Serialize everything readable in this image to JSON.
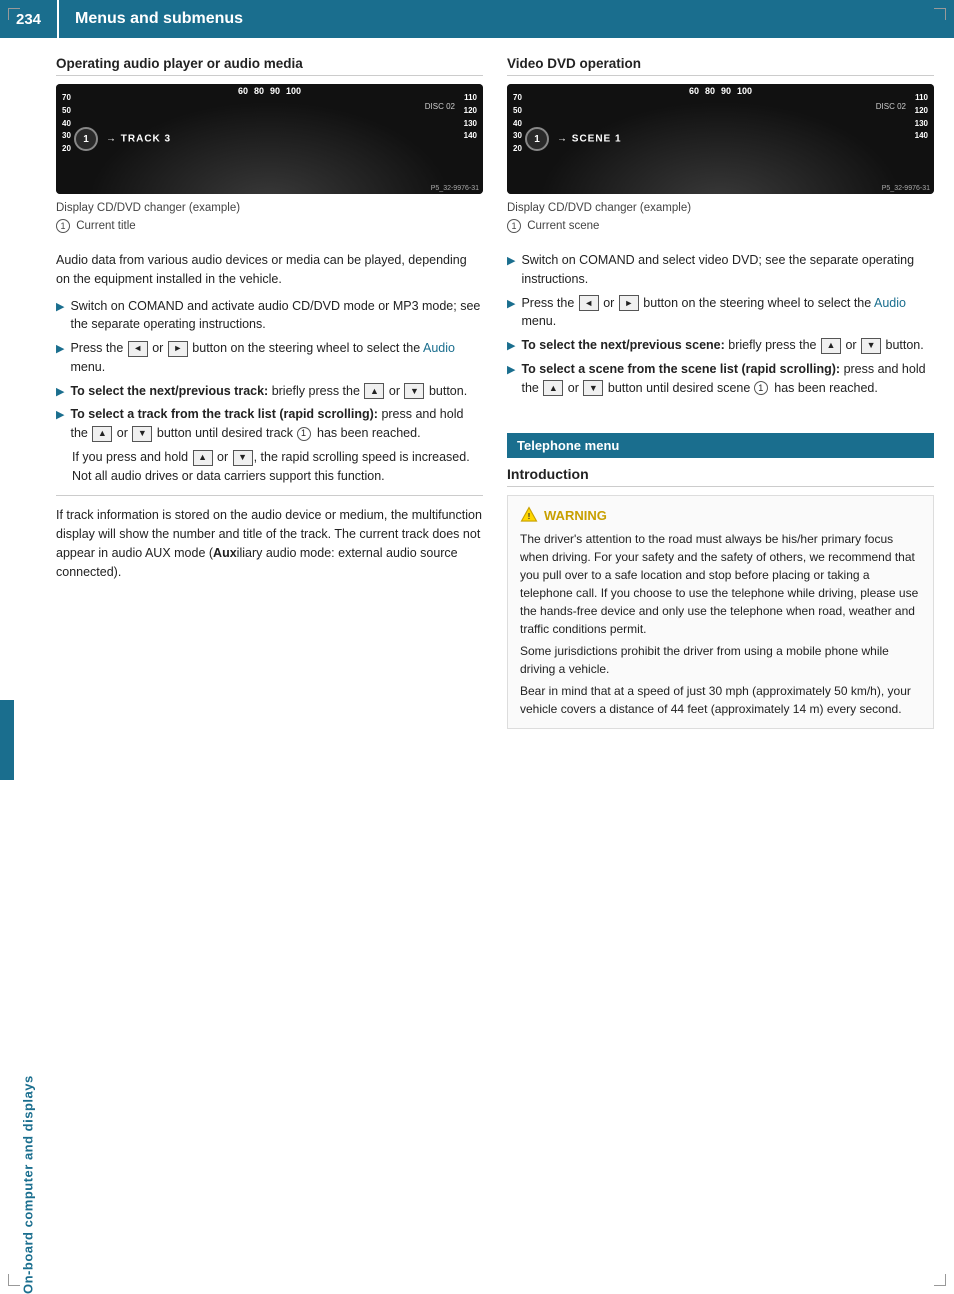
{
  "page": {
    "number": "234",
    "title": "Menus and submenus",
    "sidebar_label": "On-board computer and displays"
  },
  "left_section": {
    "heading": "Operating audio player or audio media",
    "dash_left_nums": [
      "70",
      "50",
      "40",
      "30",
      "20"
    ],
    "dash_top_nums": [
      "60",
      "80",
      "90",
      "100"
    ],
    "dash_right_nums": [
      "110",
      "120",
      "130",
      "140"
    ],
    "dash_disc": "DISC 02",
    "dash_track": "→ TRACK 3",
    "dash_circle": "1",
    "dash_p5": "P5_32-9976-31",
    "caption_line1": "Display CD/DVD changer (example)",
    "caption_circle": "1",
    "caption_line2": "Current title",
    "body_text": "Audio data from various audio devices or media can be played, depending on the equipment installed in the vehicle.",
    "bullets": [
      {
        "text": "Switch on COMAND and activate audio CD/DVD mode or MP3 mode; see the separate operating instructions."
      },
      {
        "text_parts": [
          "Press the ",
          "◄",
          " or ",
          "►",
          " button on the steering wheel to select the ",
          "Audio",
          " menu."
        ]
      },
      {
        "bold_intro": "To select the next/previous track:",
        "text_parts": [
          "briefly press the ",
          "▲",
          " or ",
          "▼",
          " button."
        ]
      },
      {
        "bold_intro": "To select a track from the track list (rapid scrolling):",
        "text_parts": [
          "press and hold the ",
          "▲",
          " or ",
          "▼",
          " button until desired track "
        ],
        "circle": "1",
        "text_end": " has been reached."
      }
    ],
    "extra_para": {
      "text_parts": [
        "If you press and hold ",
        "▲",
        " or ",
        "▼",
        ", the rapid scrolling speed is increased. Not all audio drives or data carriers support this function."
      ]
    },
    "footer_text": "If track information is stored on the audio device or medium, the multifunction display will show the number and title of the track. The current track does not appear in audio AUX mode (",
    "footer_bold": "Aux",
    "footer_text2": "iliary audio mode: external audio source connected)."
  },
  "right_section": {
    "heading": "Video DVD operation",
    "dash_disc": "DISC 02",
    "dash_track": "→ SCENE 1",
    "dash_circle": "1",
    "dash_p5": "P5_32-9976-31",
    "caption_line1": "Display CD/DVD changer (example)",
    "caption_circle": "1",
    "caption_line2": "Current scene",
    "bullets": [
      {
        "text": "Switch on COMAND and select video DVD; see the separate operating instructions."
      },
      {
        "text_parts": [
          "Press the ",
          "◄",
          " or ",
          "►",
          " button on the steering wheel to select the ",
          "Audio",
          " menu."
        ]
      },
      {
        "bold_intro": "To select the next/previous scene:",
        "text_parts": [
          "briefly press the ",
          "▲",
          " or ",
          "▼",
          " button."
        ]
      },
      {
        "bold_intro": "To select a scene from the scene list (rapid scrolling):",
        "text_parts": [
          "press and hold the ",
          "▲",
          " or ",
          "▼",
          " button until desired scene "
        ],
        "circle": "1",
        "text_end": " has been reached."
      }
    ]
  },
  "telephone_section": {
    "header": "Telephone menu",
    "intro_title": "Introduction",
    "warning_title": "WARNING",
    "warning_paragraphs": [
      "The driver's attention to the road must always be his/her primary focus when driving. For your safety and the safety of others, we recommend that you pull over to a safe location and stop before placing or taking a telephone call. If you choose to use the telephone while driving, please use the hands-free device and only use the telephone when road, weather and traffic conditions permit.",
      "Some jurisdictions prohibit the driver from using a mobile phone while driving a vehicle.",
      "Bear in mind that at a speed of just 30 mph (approximately 50 km/h), your vehicle covers a distance of 44 feet (approximately 14 m) every second."
    ]
  }
}
